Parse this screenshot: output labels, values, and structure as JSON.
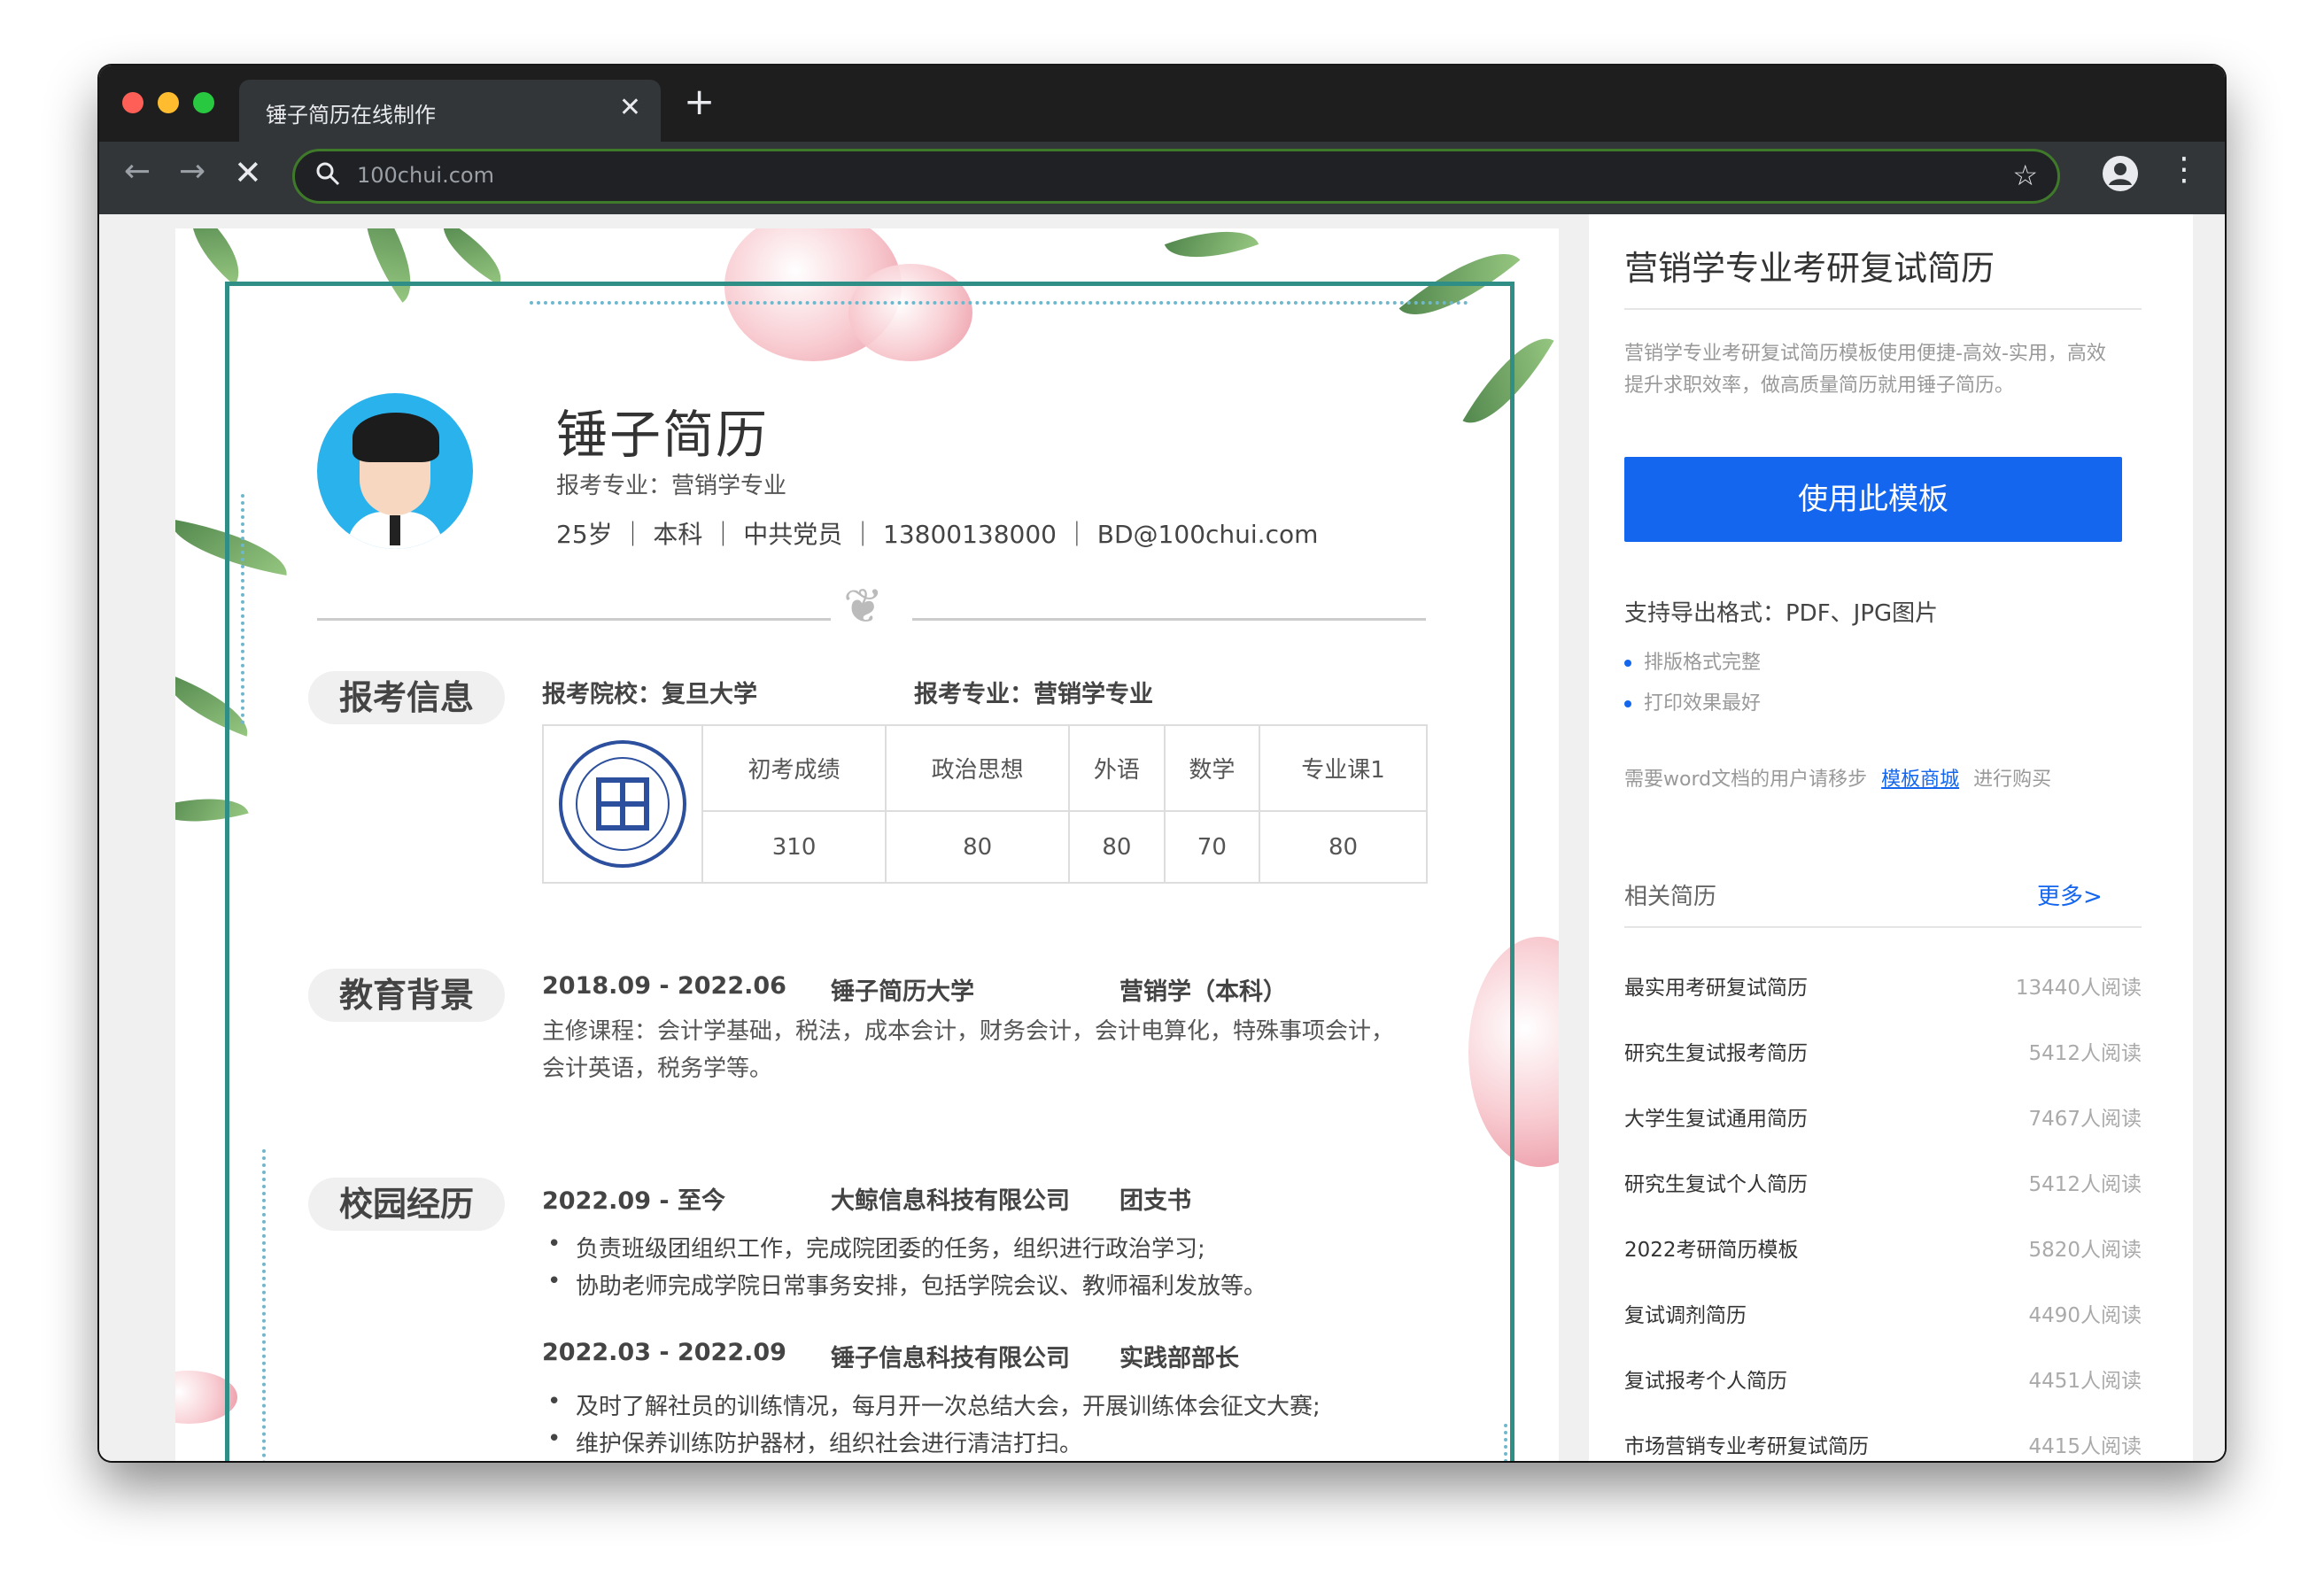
{
  "browser": {
    "tab_title": "锤子简历在线制作",
    "tab_close": "✕",
    "new_tab": "+",
    "url": "100chui.com",
    "back": "←",
    "forward": "→",
    "stop": "✕",
    "star": "☆",
    "menu": "⋮"
  },
  "resume": {
    "name": "锤子简历",
    "major_line": "报考专业：营销学专业",
    "contact_line": "25岁 ｜ 本科 ｜ 中共党员 ｜ 13800138000 ｜ BD@100chui.com",
    "sections": {
      "apply": {
        "title": "报考信息",
        "school": "报考院校：复旦大学",
        "major": "报考专业：营销学专业",
        "headers": [
          "初考成绩",
          "政治思想",
          "外语",
          "数学",
          "专业课1"
        ],
        "scores": [
          "310",
          "80",
          "80",
          "70",
          "80"
        ]
      },
      "education": {
        "title": "教育背景",
        "period": "2018.09 - 2022.06",
        "school": "锤子简历大学",
        "degree": "营销学（本科）",
        "courses": "主修课程：会计学基础，税法，成本会计，财务会计，会计电算化，特殊事项会计，会计英语，税务学等。"
      },
      "campus": {
        "title": "校园经历",
        "jobs": [
          {
            "period": "2022.09 - 至今",
            "org": "大鲸信息科技有限公司",
            "role": "团支书",
            "bullets": [
              "负责班级团组织工作，完成院团委的任务，组织进行政治学习;",
              "协助老师完成学院日常事务安排，包括学院会议、教师福利发放等。"
            ]
          },
          {
            "period": "2022.03 - 2022.09",
            "org": "锤子信息科技有限公司",
            "role": "实践部部长",
            "bullets": [
              "及时了解社员的训练情况，每月开一次总结大会，开展训练体会征文大赛;",
              "维护保养训练防护器材，组织社会进行清洁打扫。"
            ]
          }
        ]
      }
    }
  },
  "sidebar": {
    "title": "营销学专业考研复试简历",
    "description": "营销学专业考研复试简历模板使用便捷-高效-实用，高效提升求职效率，做高质量简历就用锤子简历。",
    "use_button": "使用此模板",
    "formats": "支持导出格式：PDF、JPG图片",
    "features": [
      "排版格式完整",
      "打印效果最好"
    ],
    "word_prefix": "需要word文档的用户请移步",
    "word_link": "模板商城",
    "word_suffix": "进行购买",
    "related_title": "相关简历",
    "more": "更多>",
    "related": [
      {
        "name": "最实用考研复试简历",
        "count": "13440人阅读"
      },
      {
        "name": "研究生复试报考简历",
        "count": "5412人阅读"
      },
      {
        "name": "大学生复试通用简历",
        "count": "7467人阅读"
      },
      {
        "name": "研究生复试个人简历",
        "count": "5412人阅读"
      },
      {
        "name": "2022考研简历模板",
        "count": "5820人阅读"
      },
      {
        "name": "复试调剂简历",
        "count": "4490人阅读"
      },
      {
        "name": "复试报考个人简历",
        "count": "4451人阅读"
      },
      {
        "name": "市场营销专业考研复试简历",
        "count": "4415人阅读"
      }
    ]
  },
  "colors": {
    "accent_blue": "#1466ee",
    "frame_teal": "#2f8f86",
    "avatar_bg": "#2ab2ec"
  }
}
